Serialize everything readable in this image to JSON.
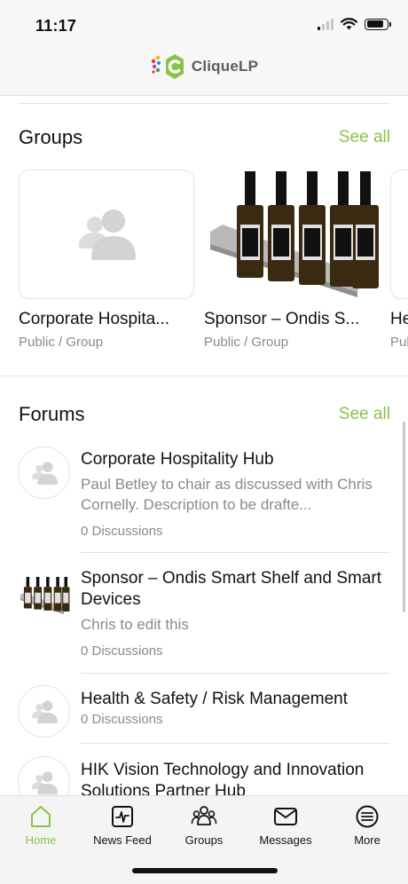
{
  "status_bar": {
    "time": "11:17"
  },
  "brand": {
    "name": "CliqueLP",
    "colors": {
      "accent": "#8bc34a",
      "logo_ring": "#8bc34a",
      "logo_dots": [
        "#e53935",
        "#ffb300",
        "#43a047",
        "#1e88e5",
        "#ab47bc"
      ]
    }
  },
  "groups": {
    "title": "Groups",
    "see_all": "See all",
    "items": [
      {
        "name": "Corporate Hospita...",
        "meta": "Public / Group",
        "image": "group-placeholder-icon"
      },
      {
        "name": "Sponsor – Ondis S...",
        "meta": "Public / Group",
        "image": "bottle-shelf-photo"
      },
      {
        "name": "He",
        "meta": "Pul",
        "image": "partial-card"
      }
    ]
  },
  "forums": {
    "title": "Forums",
    "see_all": "See all",
    "items": [
      {
        "title": "Corporate Hospitality Hub",
        "description": "Paul Betley to chair as discussed with Chris Cornelly. Description to be drafte...",
        "count": "0 Discussions",
        "avatar": "group-placeholder-icon"
      },
      {
        "title": "Sponsor – Ondis Smart Shelf and Smart Devices",
        "description": "Chris to edit this",
        "count": "0 Discussions",
        "avatar": "bottle-shelf-photo"
      },
      {
        "title": "Health & Safety / Risk Management",
        "description": "",
        "count": "0 Discussions",
        "avatar": "group-placeholder-icon"
      },
      {
        "title": "HIK Vision Technology and Innovation Solutions Partner Hub",
        "description": "",
        "count": "",
        "avatar": "group-placeholder-icon"
      }
    ]
  },
  "tabbar": {
    "active": "Home",
    "items": [
      {
        "label": "Home",
        "icon": "home-icon"
      },
      {
        "label": "News Feed",
        "icon": "news-feed-icon"
      },
      {
        "label": "Groups",
        "icon": "groups-icon"
      },
      {
        "label": "Messages",
        "icon": "mail-icon"
      },
      {
        "label": "More",
        "icon": "menu-list-icon"
      }
    ]
  }
}
